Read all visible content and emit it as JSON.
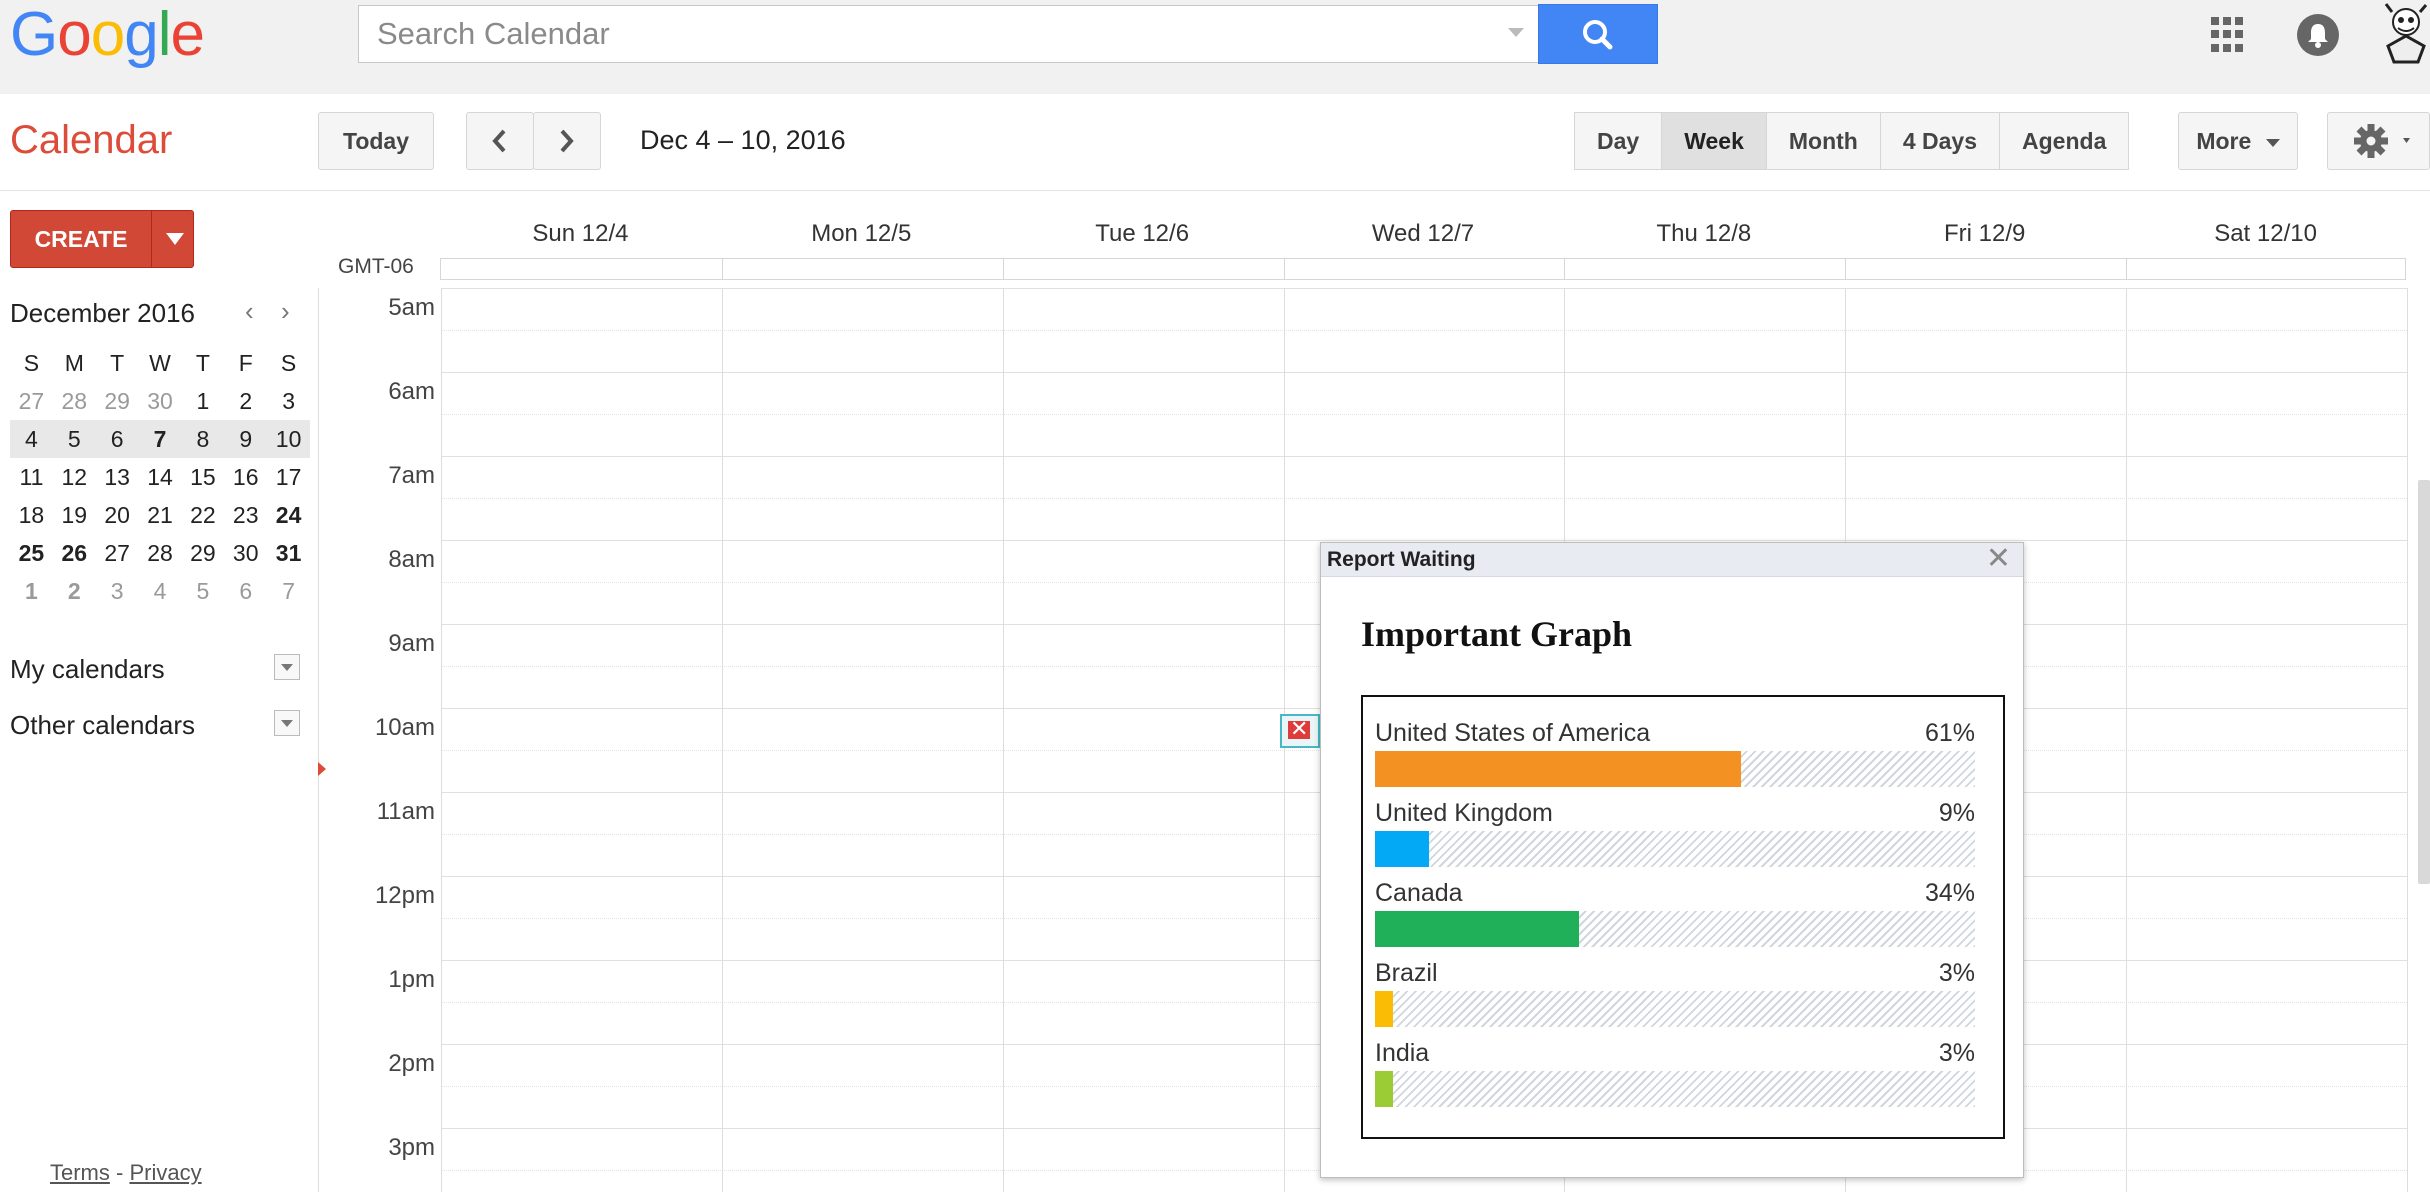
{
  "topbar": {
    "search_placeholder": "Search Calendar"
  },
  "logo": {
    "letters": [
      "G",
      "o",
      "o",
      "g",
      "l",
      "e"
    ],
    "colors": [
      "#4285f4",
      "#ea4335",
      "#fbbc05",
      "#4285f4",
      "#34a853",
      "#ea4335"
    ]
  },
  "header": {
    "app_title": "Calendar",
    "today_label": "Today",
    "date_range": "Dec 4 – 10, 2016",
    "views": [
      {
        "label": "Day",
        "active": false
      },
      {
        "label": "Week",
        "active": true
      },
      {
        "label": "Month",
        "active": false
      },
      {
        "label": "4 Days",
        "active": false
      },
      {
        "label": "Agenda",
        "active": false
      }
    ],
    "more_label": "More"
  },
  "sidebar": {
    "create_label": "CREATE",
    "mini_calendar": {
      "month": "December 2016",
      "weekdays": [
        "S",
        "M",
        "T",
        "W",
        "T",
        "F",
        "S"
      ],
      "weeks": [
        [
          {
            "d": "27",
            "s": "out"
          },
          {
            "d": "28",
            "s": "out"
          },
          {
            "d": "29",
            "s": "out"
          },
          {
            "d": "30",
            "s": "out"
          },
          {
            "d": "1",
            "s": ""
          },
          {
            "d": "2",
            "s": ""
          },
          {
            "d": "3",
            "s": ""
          }
        ],
        [
          {
            "d": "4",
            "s": ""
          },
          {
            "d": "5",
            "s": ""
          },
          {
            "d": "6",
            "s": ""
          },
          {
            "d": "7",
            "s": "bold"
          },
          {
            "d": "8",
            "s": ""
          },
          {
            "d": "9",
            "s": ""
          },
          {
            "d": "10",
            "s": ""
          }
        ],
        [
          {
            "d": "11",
            "s": ""
          },
          {
            "d": "12",
            "s": ""
          },
          {
            "d": "13",
            "s": ""
          },
          {
            "d": "14",
            "s": ""
          },
          {
            "d": "15",
            "s": ""
          },
          {
            "d": "16",
            "s": ""
          },
          {
            "d": "17",
            "s": ""
          }
        ],
        [
          {
            "d": "18",
            "s": ""
          },
          {
            "d": "19",
            "s": ""
          },
          {
            "d": "20",
            "s": ""
          },
          {
            "d": "21",
            "s": ""
          },
          {
            "d": "22",
            "s": ""
          },
          {
            "d": "23",
            "s": ""
          },
          {
            "d": "24",
            "s": "bold"
          }
        ],
        [
          {
            "d": "25",
            "s": "bold"
          },
          {
            "d": "26",
            "s": "bold"
          },
          {
            "d": "27",
            "s": ""
          },
          {
            "d": "28",
            "s": ""
          },
          {
            "d": "29",
            "s": ""
          },
          {
            "d": "30",
            "s": ""
          },
          {
            "d": "31",
            "s": "bold"
          }
        ],
        [
          {
            "d": "1",
            "s": "outbold"
          },
          {
            "d": "2",
            "s": "outbold"
          },
          {
            "d": "3",
            "s": "out"
          },
          {
            "d": "4",
            "s": "out"
          },
          {
            "d": "5",
            "s": "out"
          },
          {
            "d": "6",
            "s": "out"
          },
          {
            "d": "7",
            "s": "out"
          }
        ]
      ],
      "highlight_week": 1
    },
    "my_calendars": "My calendars",
    "other_calendars": "Other calendars",
    "terms": "Terms",
    "separator": "-",
    "privacy": "Privacy"
  },
  "week": {
    "timezone": "GMT-06",
    "days": [
      "Sun 12/4",
      "Mon 12/5",
      "Tue 12/6",
      "Wed 12/7",
      "Thu 12/8",
      "Fri 12/9",
      "Sat 12/10"
    ],
    "hours": [
      "5am",
      "6am",
      "7am",
      "8am",
      "9am",
      "10am",
      "11am",
      "12pm",
      "1pm",
      "2pm",
      "3pm"
    ]
  },
  "popup": {
    "header_title": "Report Waiting",
    "close_glyph": "✕",
    "graph_title": "Important Graph"
  },
  "chart_data": {
    "type": "bar",
    "title": "Important Graph",
    "categories": [
      "United States of America",
      "United Kingdom",
      "Canada",
      "Brazil",
      "India"
    ],
    "values": [
      61,
      9,
      34,
      3,
      3
    ],
    "labels": [
      "61%",
      "9%",
      "34%",
      "3%",
      "3%"
    ],
    "colors": [
      "#f39122",
      "#03a9f4",
      "#20b05a",
      "#fbbc05",
      "#9bcb35"
    ],
    "ylim": [
      0,
      100
    ]
  }
}
